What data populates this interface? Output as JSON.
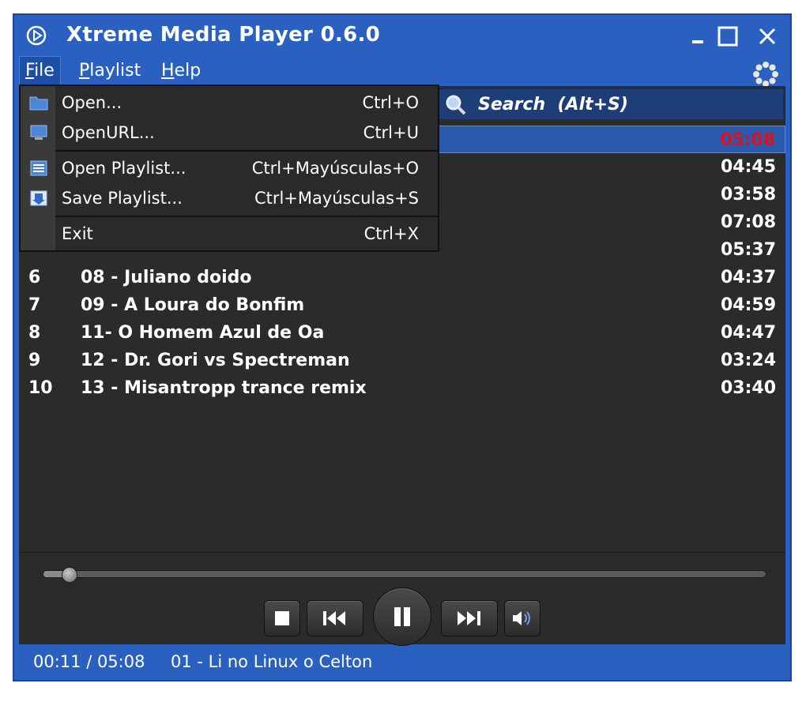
{
  "window": {
    "title": "Xtreme Media Player 0.6.0",
    "accent_color": "#2a61c0",
    "panel_color": "#2b2b2b"
  },
  "menubar": {
    "file": {
      "prefix": "F",
      "rest": "ile"
    },
    "playlist": {
      "prefix": "P",
      "rest": "laylist"
    },
    "help": {
      "prefix": "H",
      "rest": "elp"
    }
  },
  "file_menu": {
    "items": [
      {
        "label": "Open...",
        "shortcut": "Ctrl+O",
        "icon": "folder-icon"
      },
      {
        "label": "OpenURL...",
        "shortcut": "Ctrl+U",
        "icon": "computer-icon"
      },
      {
        "label": "Open Playlist...",
        "shortcut": "Ctrl+Mayúsculas+O",
        "icon": "playlist-open-icon"
      },
      {
        "label": "Save Playlist...",
        "shortcut": "Ctrl+Mayúsculas+S",
        "icon": "playlist-save-icon"
      },
      {
        "label": "Exit",
        "shortcut": "Ctrl+X",
        "icon": ""
      }
    ]
  },
  "search": {
    "placeholder": "Search  (Alt+S)"
  },
  "playlist": {
    "current_index": 0,
    "current_color": "#e0101a",
    "rows": [
      {
        "num": "",
        "name": "",
        "duration": "05:08"
      },
      {
        "num": "",
        "name": "",
        "duration": "04:45"
      },
      {
        "num": "",
        "name": "",
        "duration": "03:58"
      },
      {
        "num": "",
        "name": "",
        "duration": "07:08"
      },
      {
        "num": "",
        "name": "",
        "duration": "05:37"
      },
      {
        "num": "6",
        "name": "08 - Juliano doido",
        "duration": "04:37"
      },
      {
        "num": "7",
        "name": "09 - A Loura do Bonfim",
        "duration": "04:59"
      },
      {
        "num": "8",
        "name": "11- O Homem Azul de Oa",
        "duration": "04:47"
      },
      {
        "num": "9",
        "name": "12 - Dr. Gori vs Spectreman",
        "duration": "03:24"
      },
      {
        "num": "10",
        "name": "13 - Misantropp trance remix",
        "duration": "03:40"
      }
    ]
  },
  "seek": {
    "progress_fraction": 0.035
  },
  "controls": {
    "stop": "stop-icon",
    "previous": "previous-icon",
    "pause": "pause-icon",
    "next": "next-icon",
    "volume": "volume-icon"
  },
  "status": {
    "time": "00:11 / 05:08",
    "track": "01 - Li no Linux o Celton"
  }
}
